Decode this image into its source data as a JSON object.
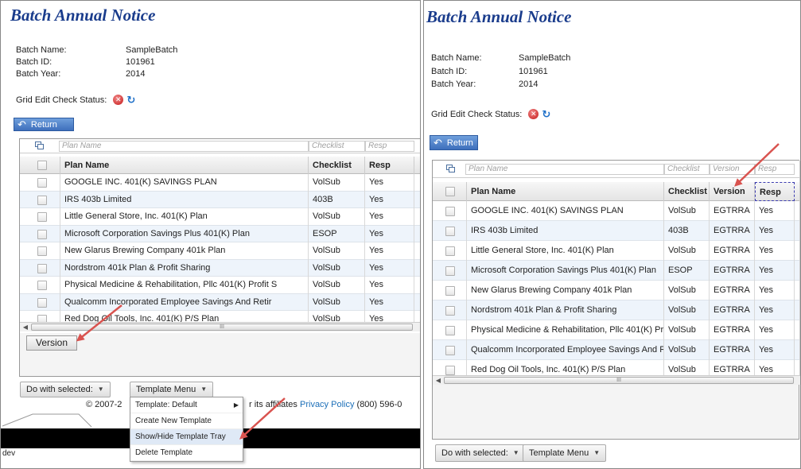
{
  "title": "Batch Annual Notice",
  "batch": {
    "name_label": "Batch Name:",
    "name_value": "SampleBatch",
    "id_label": "Batch ID:",
    "id_value": "101961",
    "year_label": "Batch Year:",
    "year_value": "2014"
  },
  "status_label": "Grid Edit Check Status:",
  "return_label": "Return",
  "grid": {
    "filter_placeholders": {
      "plan": "Plan Name",
      "checklist": "Checklist",
      "version": "Version",
      "resp": "Resp"
    },
    "columns": {
      "plan": "Plan Name",
      "checklist": "Checklist",
      "version": "Version",
      "resp": "Resp"
    },
    "rows": [
      {
        "plan": "GOOGLE INC. 401(K) SAVINGS PLAN",
        "checklist": "VolSub",
        "version": "EGTRRA",
        "resp": "Yes"
      },
      {
        "plan": "IRS 403b Limited",
        "checklist": "403B",
        "version": "EGTRRA",
        "resp": "Yes"
      },
      {
        "plan": "Little General Store, Inc. 401(K) Plan",
        "checklist": "VolSub",
        "version": "EGTRRA",
        "resp": "Yes"
      },
      {
        "plan": "Microsoft Corporation Savings Plus 401(K) Plan",
        "checklist": "ESOP",
        "version": "EGTRRA",
        "resp": "Yes"
      },
      {
        "plan": "New Glarus Brewing Company 401k Plan",
        "checklist": "VolSub",
        "version": "EGTRRA",
        "resp": "Yes"
      },
      {
        "plan": "Nordstrom 401k Plan & Profit Sharing",
        "checklist": "VolSub",
        "version": "EGTRRA",
        "resp": "Yes"
      },
      {
        "plan": "Physical Medicine & Rehabilitation, Pllc 401(K) Profit S",
        "checklist": "VolSub",
        "version": "EGTRRA",
        "resp": "Yes"
      },
      {
        "plan": "Qualcomm Incorporated Employee Savings And Retir",
        "checklist": "VolSub",
        "version": "EGTRRA",
        "resp": "Yes"
      },
      {
        "plan": "Red Dog Oil Tools, Inc. 401(K) P/S Plan",
        "checklist": "VolSub",
        "version": "EGTRRA",
        "resp": "Yes"
      }
    ],
    "scroll_grip": "III"
  },
  "version_tray_label": "Version",
  "do_with_selected": "Do with selected:",
  "template_menu": "Template Menu",
  "menu": {
    "items": [
      "Template: Default",
      "Create New Template",
      "Show/Hide Template Tray",
      "Delete Template"
    ]
  },
  "footer": {
    "copyright": "© 2007-2",
    "affiliates": "r its affiliates",
    "privacy": "Privacy Policy",
    "phone": "(800) 596-0"
  },
  "env_label": "dev",
  "colors": {
    "title": "#1a3c8c",
    "link": "#1c6fb8",
    "annotation_arrow": "#d9534f",
    "row_alt": "#eef4fb"
  }
}
